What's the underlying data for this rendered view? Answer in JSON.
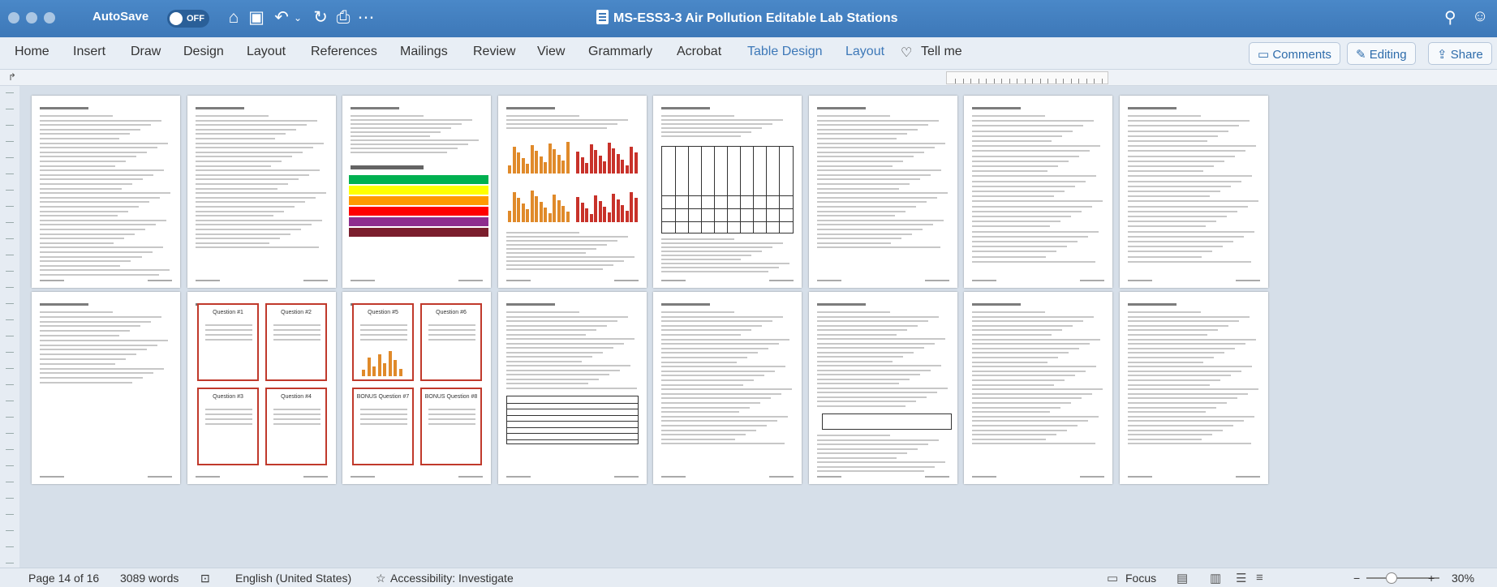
{
  "titlebar": {
    "autosave_label": "AutoSave",
    "autosave_state": "OFF",
    "document_title": "MS-ESS3-3 Air Pollution Editable Lab Stations",
    "quick_access": [
      "home-icon",
      "save-icon",
      "undo-icon",
      "redo-icon",
      "print-icon",
      "more-icon"
    ]
  },
  "ribbon": {
    "tabs": [
      "Home",
      "Insert",
      "Draw",
      "Design",
      "Layout",
      "References",
      "Mailings",
      "Review",
      "View",
      "Grammarly",
      "Acrobat",
      "Table Design",
      "Layout"
    ],
    "tell_me": "Tell me",
    "comments": "Comments",
    "editing": "Editing",
    "share": "Share",
    "accent_color": "#3d78b8"
  },
  "document": {
    "pages_row1": 8,
    "pages_row2": 8,
    "aqi_title": "AIR QUALITY INDEX",
    "aqi_colors": [
      "#00b050",
      "#ffff00",
      "#ff9900",
      "#ff0000",
      "#8e2d8e",
      "#7b1e2d"
    ],
    "cards": [
      {
        "label": "Question #1"
      },
      {
        "label": "Question #2"
      },
      {
        "label": "Question #3"
      },
      {
        "label": "Question #4"
      },
      {
        "label": "Question #5"
      },
      {
        "label": "Question #6"
      },
      {
        "label": "BONUS Question #7"
      },
      {
        "label": "BONUS Question #8"
      }
    ]
  },
  "status": {
    "page": "Page 14 of 16",
    "words": "3089 words",
    "language": "English (United States)",
    "accessibility": "Accessibility: Investigate",
    "focus": "Focus",
    "zoom": "30%",
    "zoom_level_percent": 30
  }
}
